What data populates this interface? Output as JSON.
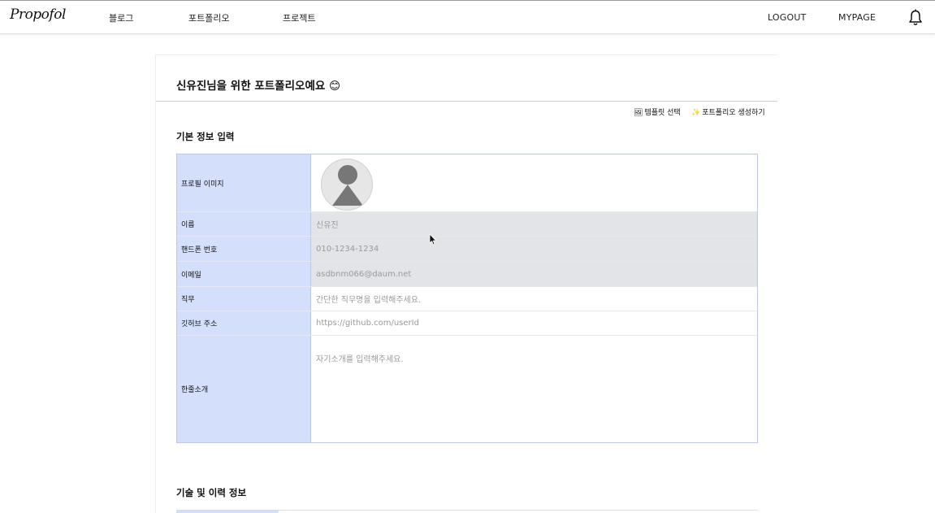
{
  "nav": {
    "logo": "Propofol",
    "links": [
      "블로그",
      "포트폴리오",
      "프로젝트"
    ],
    "logout": "LOGOUT",
    "mypage": "MYPAGE",
    "bell_icon": "bell-icon"
  },
  "page": {
    "title": "신유진님을 위한 포트폴리오예요 😊",
    "template_btn": "템플릿 선택",
    "template_icon": "🖼",
    "create_btn": "포트폴리오 생성하기",
    "create_icon": "✨"
  },
  "basic": {
    "section_title": "기본 정보 입력",
    "profile_label": "프로필 이미지",
    "name_label": "이름",
    "name_value": "신유진",
    "phone_label": "핸드폰 번호",
    "phone_value": "010-1234-1234",
    "email_label": "이메일",
    "email_value": "asdbnm066@daum.net",
    "job_label": "직무",
    "job_placeholder": "간단한 직무명을 입력해주세요.",
    "github_label": "깃허브 주소",
    "github_placeholder": "https://github.com/userId",
    "intro_label": "한줄소개",
    "intro_placeholder": "자기소개를 입력해주세요."
  },
  "skills": {
    "section_title": "기술 및 이력 정보"
  },
  "colors": {
    "label_bg": "#d4e0fb",
    "disabled_bg": "#e3e4e8",
    "border": "#b9c8e6"
  }
}
